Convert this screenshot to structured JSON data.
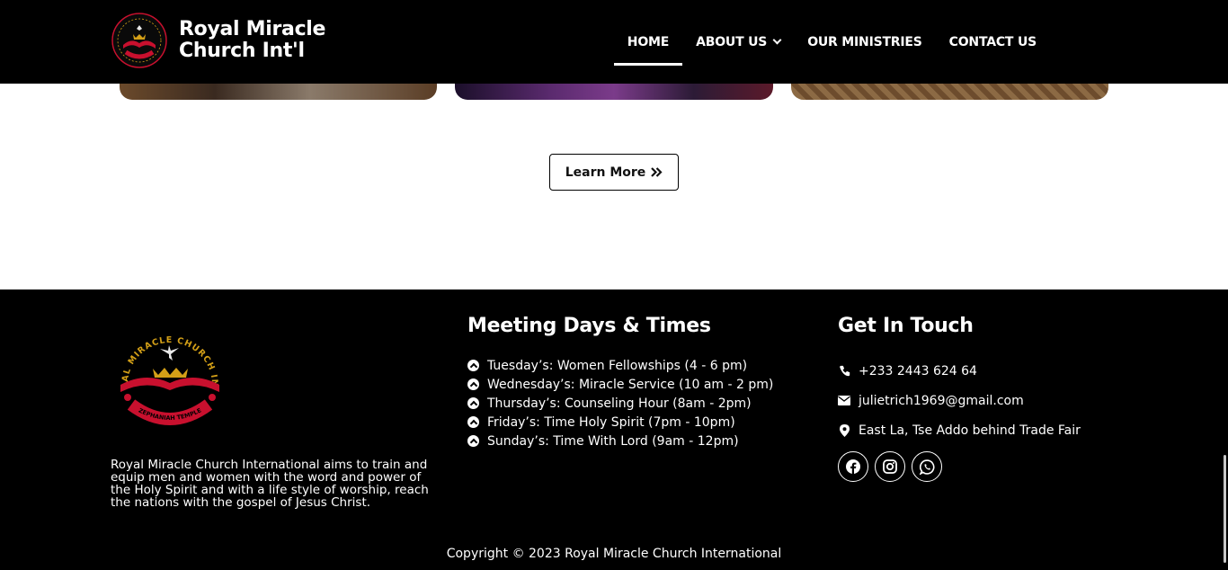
{
  "header": {
    "brand_name_line1": "Royal Miracle",
    "brand_name_line2": "Church Int'l",
    "nav": [
      {
        "label": "HOME"
      },
      {
        "label": "ABOUT US"
      },
      {
        "label": "OUR MINISTRIES"
      },
      {
        "label": "CONTACT US"
      }
    ]
  },
  "main": {
    "learn_more_label": "Learn More",
    "learn_more_icon": "double-chevron-right-icon"
  },
  "footer": {
    "logo_text_top": "ROYAL MIRACLE CHURCH INT'L",
    "logo_text_bottom": "ZEPHANIAH TEMPLE",
    "about": "Royal Miracle Church International aims to train and equip men and women with the word and power of the Holy Spirit and with a life style of worship, reach the nations with the gospel of Jesus Christ.",
    "meeting_title": "Meeting Days & Times",
    "meetings": [
      "Tuesday’s: Women Fellowships (4 - 6 pm)",
      "Wednesday’s: Miracle Service (10 am - 2 pm)",
      "Thursday’s: Counseling Hour (8am - 2pm)",
      "Friday’s: Time Holy Spirit (7pm - 10pm)",
      "Sunday’s: Time With Lord (9am - 12pm)"
    ],
    "touch_title": "Get In Touch",
    "phone": "+233 2443 624 64",
    "email": "julietrich1969@gmail.com",
    "address": "East La, Tse Addo behind Trade Fair",
    "socials": [
      "facebook-icon",
      "instagram-icon",
      "whatsapp-icon"
    ],
    "copyright": "Copyright © 2023 Royal Miracle Church International"
  },
  "colors": {
    "header_bg": "#000000",
    "footer_bg": "#000000",
    "text_light": "#ffffff",
    "logo_red": "#c8102e",
    "logo_gold": "#d4a017"
  }
}
